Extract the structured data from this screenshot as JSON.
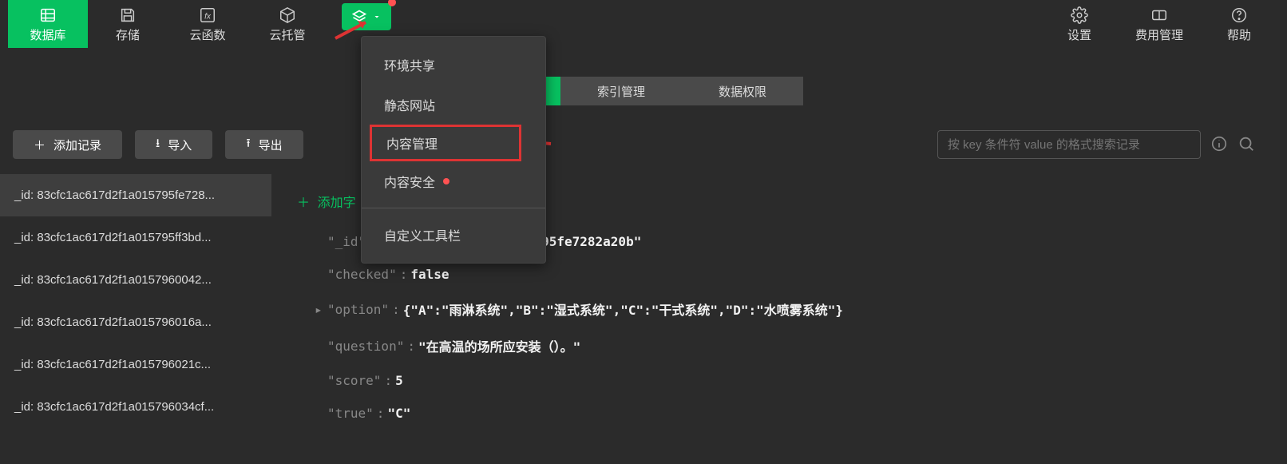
{
  "topbar": {
    "left": [
      {
        "name": "database",
        "label": "数据库",
        "icon": "database-icon",
        "active": true
      },
      {
        "name": "storage",
        "label": "存储",
        "icon": "save-icon"
      },
      {
        "name": "cloud-fn",
        "label": "云函数",
        "icon": "fx-icon"
      },
      {
        "name": "cloud-host",
        "label": "云托管",
        "icon": "cube-icon"
      }
    ],
    "right": [
      {
        "name": "settings",
        "label": "设置",
        "icon": "gear-icon"
      },
      {
        "name": "billing",
        "label": "费用管理",
        "icon": "billing-icon"
      },
      {
        "name": "help",
        "label": "帮助",
        "icon": "help-icon"
      }
    ]
  },
  "dropdown": {
    "items": [
      {
        "label": "环境共享"
      },
      {
        "label": "静态网站"
      },
      {
        "label": "内容管理",
        "highlight": true
      },
      {
        "label": "内容安全",
        "dot": true
      }
    ],
    "footer": "自定义工具栏"
  },
  "tabs": [
    "索引管理",
    "数据权限"
  ],
  "actions": {
    "add_record": "添加记录",
    "import": "导入",
    "export": "导出"
  },
  "add_field": "添加字",
  "search": {
    "placeholder": "按 key 条件符 value 的格式搜索记录"
  },
  "records": [
    "_id: 83cfc1ac617d2f1a015795fe728...",
    "_id: 83cfc1ac617d2f1a015795ff3bd...",
    "_id: 83cfc1ac617d2f1a0157960042...",
    "_id: 83cfc1ac617d2f1a015796016a...",
    "_id: 83cfc1ac617d2f1a015796021c...",
    "_id: 83cfc1ac617d2f1a015796034cf..."
  ],
  "json": {
    "lines": [
      {
        "key": "\"_id\"",
        "val": "\"83cfc1ac617d2f1a015795fe7282a20b\""
      },
      {
        "key": "\"checked\"",
        "val": "false"
      },
      {
        "key": "\"option\"",
        "val": "{\"A\":\"雨淋系统\",\"B\":\"湿式系统\",\"C\":\"干式系统\",\"D\":\"水喷雾系统\"}",
        "expand": true
      },
      {
        "key": "\"question\"",
        "val": "\"在高温的场所应安装（）。\""
      },
      {
        "key": "\"score\"",
        "val": "5"
      },
      {
        "key": "\"true\"",
        "val": "\"C\""
      }
    ]
  }
}
